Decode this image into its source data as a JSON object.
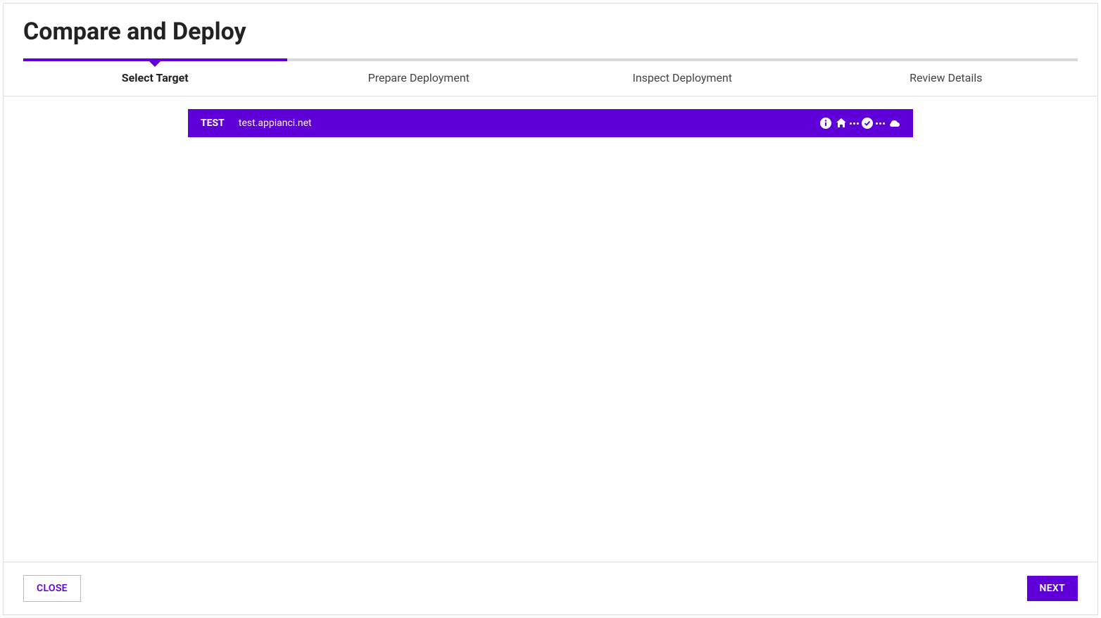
{
  "header": {
    "title": "Compare and Deploy"
  },
  "stepper": {
    "steps": [
      {
        "label": "Select Target",
        "active": true
      },
      {
        "label": "Prepare Deployment",
        "active": false
      },
      {
        "label": "Inspect Deployment",
        "active": false
      },
      {
        "label": "Review Details",
        "active": false
      }
    ]
  },
  "targets": [
    {
      "name": "TEST",
      "url": "test.appianci.net",
      "selected": true,
      "icons": [
        "info-icon",
        "home-icon",
        "dots",
        "check-circle-icon",
        "dots",
        "cloud-icon"
      ]
    }
  ],
  "footer": {
    "close_label": "CLOSE",
    "next_label": "NEXT"
  },
  "colors": {
    "accent": "#5f00d8"
  }
}
